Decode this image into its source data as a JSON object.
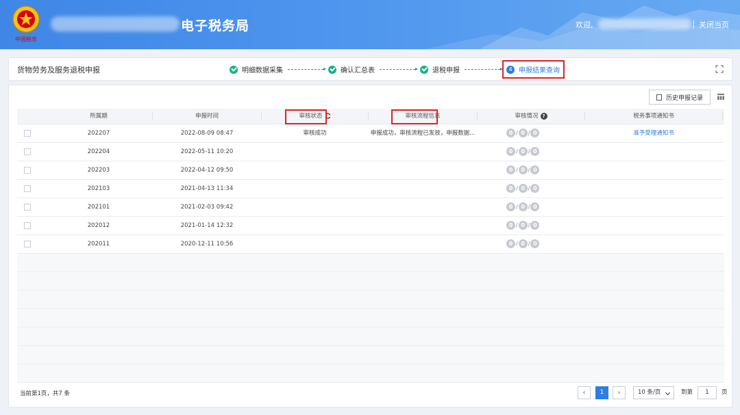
{
  "header": {
    "emblem_text": "中国税务",
    "title": "电子税务局",
    "welcome": "欢迎,",
    "close_label": "关闭当页"
  },
  "stepbar": {
    "page_title": "货物劳务及服务退税申报",
    "steps": [
      {
        "label": "明细数据采集",
        "status": "done"
      },
      {
        "label": "确认汇总表",
        "status": "done"
      },
      {
        "label": "退税申报",
        "status": "done"
      },
      {
        "number": "4",
        "label": "申报结果查询",
        "status": "active"
      }
    ]
  },
  "toolbar": {
    "history_label": "历史申报记录"
  },
  "table": {
    "columns": [
      "所属期",
      "申报时间",
      "审核状态",
      "审核流程信息",
      "审核情况",
      "税务事项通知书"
    ],
    "rows": [
      {
        "period": "202207",
        "time": "2022-08-09 08:47",
        "status": "审核成功",
        "process": "申报成功，审核流程已发放，申报数据...",
        "counts": [
          "0",
          "0",
          "0"
        ],
        "notice": "准予受理通知书"
      },
      {
        "period": "202204",
        "time": "2022-05-11 10:20",
        "status": "",
        "process": "",
        "counts": [
          "0",
          "0",
          "0"
        ],
        "notice": ""
      },
      {
        "period": "202203",
        "time": "2022-04-12 09:50",
        "status": "",
        "process": "",
        "counts": [
          "0",
          "0",
          "0"
        ],
        "notice": ""
      },
      {
        "period": "202103",
        "time": "2021-04-13 11:34",
        "status": "",
        "process": "",
        "counts": [
          "0",
          "0",
          "0"
        ],
        "notice": ""
      },
      {
        "period": "202101",
        "time": "2021-02-03 09:42",
        "status": "",
        "process": "",
        "counts": [
          "0",
          "0",
          "0"
        ],
        "notice": ""
      },
      {
        "period": "202012",
        "time": "2021-01-14 12:32",
        "status": "",
        "process": "",
        "counts": [
          "0",
          "0",
          "0"
        ],
        "notice": ""
      },
      {
        "period": "202011",
        "time": "2020-12-11 10:56",
        "status": "",
        "process": "",
        "counts": [
          "0",
          "0",
          "0"
        ],
        "notice": ""
      }
    ]
  },
  "pagination": {
    "summary": "当前第1页，共7 条",
    "prev": "‹",
    "current_page": "1",
    "next": "›",
    "page_size": "10 条/页",
    "goto_prefix": "到第",
    "goto_value": "1",
    "goto_suffix": "页"
  },
  "colors": {
    "header_blue": "#4d95ee",
    "accent": "#2f7de1",
    "done_green": "#19b188",
    "highlight_red": "#e02020"
  }
}
